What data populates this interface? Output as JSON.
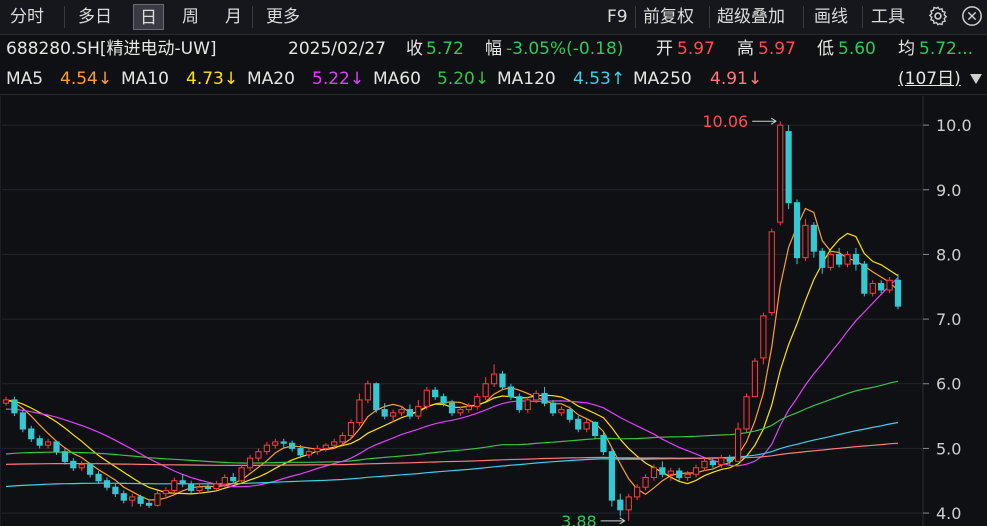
{
  "toolbar": {
    "left_items": [
      "分时",
      "多日",
      "日",
      "周",
      "月",
      "更多"
    ],
    "active_index": 2,
    "right_items": [
      "F9",
      "前复权",
      "超级叠加",
      "画线",
      "工具"
    ],
    "settings_icon": "gear-icon",
    "close_icon": "close-icon"
  },
  "info": {
    "code_name": "688280.SH[精进电动-UW]",
    "date": "2025/02/27",
    "close_label": "收",
    "close_value": "5.72",
    "change_label": "幅",
    "change_value": "-3.05%(-0.18)",
    "open_label": "开",
    "open_value": "5.97",
    "high_label": "高",
    "high_value": "5.97",
    "low_label": "低",
    "low_value": "5.60",
    "avg_label": "均",
    "avg_value": "5.72..."
  },
  "ma_bar": {
    "items": [
      {
        "label": "MA5",
        "value": "4.54↓",
        "color": "#ff9d2e"
      },
      {
        "label": "MA10",
        "value": "4.73↓",
        "color": "#ffe100"
      },
      {
        "label": "MA20",
        "value": "5.22↓",
        "color": "#e040fb"
      },
      {
        "label": "MA60",
        "value": "5.20↓",
        "color": "#39c24a"
      },
      {
        "label": "MA120",
        "value": "4.53↑",
        "color": "#3fd0e8"
      },
      {
        "label": "MA250",
        "value": "4.91↓",
        "color": "#ff7a7a"
      }
    ],
    "period": "(107日)",
    "dropdown_icon": "triangle-down-icon"
  },
  "chart_data": {
    "type": "candlestick",
    "ylim": [
      3.8,
      10.45
    ],
    "y_ticks": [
      "10.0",
      "9.0",
      "8.0",
      "7.0",
      "6.0",
      "5.0",
      "4.0"
    ],
    "annotations": {
      "max_label": "10.06",
      "min_label": "3.88"
    },
    "colors": {
      "up": "#ff3b3b",
      "down": "#35c8d2",
      "bg": "#0f1014",
      "grid": "#23252b"
    },
    "candles": [
      [
        5.7,
        5.75,
        5.8,
        5.66
      ],
      [
        5.75,
        5.55,
        5.8,
        5.5
      ],
      [
        5.55,
        5.3,
        5.6,
        5.25
      ],
      [
        5.3,
        5.15,
        5.35,
        5.1
      ],
      [
        5.15,
        5.05,
        5.2,
        5.0
      ],
      [
        5.05,
        5.1,
        5.15,
        5.0
      ],
      [
        5.1,
        4.95,
        5.12,
        4.9
      ],
      [
        4.95,
        4.8,
        5.0,
        4.75
      ],
      [
        4.8,
        4.7,
        4.85,
        4.65
      ],
      [
        4.7,
        4.75,
        4.8,
        4.65
      ],
      [
        4.75,
        4.6,
        4.78,
        4.55
      ],
      [
        4.6,
        4.5,
        4.65,
        4.45
      ],
      [
        4.5,
        4.4,
        4.55,
        4.35
      ],
      [
        4.4,
        4.3,
        4.45,
        4.25
      ],
      [
        4.3,
        4.2,
        4.35,
        4.15
      ],
      [
        4.2,
        4.25,
        4.3,
        4.1
      ],
      [
        4.25,
        4.15,
        4.28,
        4.1
      ],
      [
        4.15,
        4.12,
        4.2,
        4.08
      ],
      [
        4.12,
        4.3,
        4.35,
        4.1
      ],
      [
        4.3,
        4.35,
        4.4,
        4.25
      ],
      [
        4.35,
        4.5,
        4.55,
        4.3
      ],
      [
        4.5,
        4.45,
        4.6,
        4.4
      ],
      [
        4.45,
        4.35,
        4.5,
        4.3
      ],
      [
        4.35,
        4.4,
        4.45,
        4.3
      ],
      [
        4.4,
        4.38,
        4.45,
        4.32
      ],
      [
        4.38,
        4.45,
        4.5,
        4.35
      ],
      [
        4.45,
        4.55,
        4.6,
        4.4
      ],
      [
        4.55,
        4.5,
        4.62,
        4.45
      ],
      [
        4.5,
        4.7,
        4.75,
        4.48
      ],
      [
        4.7,
        4.85,
        4.9,
        4.65
      ],
      [
        4.85,
        4.95,
        5.0,
        4.8
      ],
      [
        4.95,
        5.05,
        5.1,
        4.9
      ],
      [
        5.05,
        5.1,
        5.15,
        5.0
      ],
      [
        5.1,
        5.08,
        5.15,
        5.02
      ],
      [
        5.08,
        5.0,
        5.12,
        4.95
      ],
      [
        5.0,
        4.9,
        5.05,
        4.85
      ],
      [
        4.9,
        4.95,
        5.0,
        4.85
      ],
      [
        4.95,
        5.0,
        5.05,
        4.9
      ],
      [
        5.0,
        5.05,
        5.08,
        4.95
      ],
      [
        5.05,
        5.1,
        5.15,
        5.0
      ],
      [
        5.1,
        5.2,
        5.25,
        5.05
      ],
      [
        5.2,
        5.4,
        5.45,
        5.15
      ],
      [
        5.4,
        5.75,
        5.85,
        5.35
      ],
      [
        5.75,
        6.0,
        6.05,
        5.7
      ],
      [
        6.0,
        5.6,
        6.02,
        5.55
      ],
      [
        5.6,
        5.5,
        5.7,
        5.45
      ],
      [
        5.5,
        5.55,
        5.6,
        5.4
      ],
      [
        5.55,
        5.6,
        5.65,
        5.5
      ],
      [
        5.6,
        5.5,
        5.68,
        5.45
      ],
      [
        5.5,
        5.65,
        5.75,
        5.45
      ],
      [
        5.65,
        5.9,
        5.95,
        5.6
      ],
      [
        5.9,
        5.8,
        5.95,
        5.75
      ],
      [
        5.8,
        5.7,
        5.85,
        5.65
      ],
      [
        5.7,
        5.55,
        5.75,
        5.5
      ],
      [
        5.55,
        5.6,
        5.65,
        5.5
      ],
      [
        5.6,
        5.65,
        5.7,
        5.55
      ],
      [
        5.65,
        5.8,
        5.85,
        5.6
      ],
      [
        5.8,
        6.0,
        6.1,
        5.75
      ],
      [
        6.0,
        6.15,
        6.3,
        5.95
      ],
      [
        6.15,
        5.95,
        6.2,
        5.9
      ],
      [
        5.95,
        5.8,
        6.0,
        5.75
      ],
      [
        5.8,
        5.6,
        5.85,
        5.55
      ],
      [
        5.6,
        5.75,
        5.8,
        5.55
      ],
      [
        5.75,
        5.85,
        5.9,
        5.7
      ],
      [
        5.85,
        5.7,
        5.95,
        5.65
      ],
      [
        5.7,
        5.55,
        5.75,
        5.5
      ],
      [
        5.55,
        5.6,
        5.65,
        5.5
      ],
      [
        5.6,
        5.45,
        5.65,
        5.4
      ],
      [
        5.45,
        5.3,
        5.5,
        5.25
      ],
      [
        5.3,
        5.4,
        5.45,
        5.25
      ],
      [
        5.4,
        5.2,
        5.42,
        5.15
      ],
      [
        5.2,
        4.95,
        5.25,
        4.9
      ],
      [
        4.95,
        4.2,
        5.0,
        4.1
      ],
      [
        4.2,
        4.05,
        4.3,
        3.95
      ],
      [
        4.05,
        4.25,
        4.3,
        3.88
      ],
      [
        4.25,
        4.4,
        4.45,
        4.2
      ],
      [
        4.4,
        4.55,
        4.6,
        4.35
      ],
      [
        4.55,
        4.7,
        4.75,
        4.5
      ],
      [
        4.7,
        4.6,
        4.8,
        4.55
      ],
      [
        4.6,
        4.65,
        4.7,
        4.5
      ],
      [
        4.65,
        4.55,
        4.7,
        4.5
      ],
      [
        4.55,
        4.6,
        4.65,
        4.5
      ],
      [
        4.6,
        4.7,
        4.75,
        4.55
      ],
      [
        4.7,
        4.8,
        4.85,
        4.65
      ],
      [
        4.8,
        4.75,
        4.85,
        4.7
      ],
      [
        4.75,
        4.85,
        4.9,
        4.7
      ],
      [
        4.85,
        4.8,
        4.9,
        4.75
      ],
      [
        4.8,
        5.3,
        5.4,
        4.8
      ],
      [
        5.3,
        5.8,
        5.85,
        5.25
      ],
      [
        5.8,
        6.35,
        6.4,
        5.8
      ],
      [
        6.4,
        7.05,
        7.1,
        6.3
      ],
      [
        7.1,
        8.35,
        8.4,
        7.05
      ],
      [
        8.5,
        10.0,
        10.06,
        8.45
      ],
      [
        9.9,
        8.8,
        10.0,
        8.7
      ],
      [
        8.8,
        7.95,
        8.85,
        7.85
      ],
      [
        7.95,
        8.45,
        8.55,
        7.9
      ],
      [
        8.45,
        8.05,
        8.5,
        7.95
      ],
      [
        8.05,
        7.8,
        8.1,
        7.7
      ],
      [
        7.8,
        8.0,
        8.05,
        7.75
      ],
      [
        8.0,
        7.85,
        8.1,
        7.8
      ],
      [
        7.85,
        8.0,
        8.05,
        7.8
      ],
      [
        8.0,
        7.85,
        8.1,
        7.75
      ],
      [
        7.85,
        7.4,
        7.9,
        7.35
      ],
      [
        7.4,
        7.55,
        7.6,
        7.35
      ],
      [
        7.55,
        7.45,
        7.6,
        7.4
      ],
      [
        7.45,
        7.6,
        7.65,
        7.4
      ],
      [
        7.6,
        7.2,
        7.7,
        7.15
      ]
    ]
  }
}
